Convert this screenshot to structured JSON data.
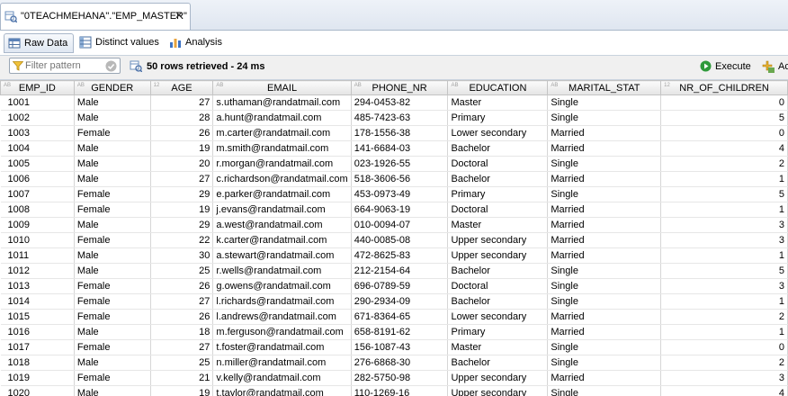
{
  "editor_tab": {
    "title": "\"0TEACHMEHANA\".\"EMP_MASTER\"",
    "close": "✕"
  },
  "subtabs": [
    {
      "label": "Raw Data",
      "active": true
    },
    {
      "label": "Distinct values",
      "active": false
    },
    {
      "label": "Analysis",
      "active": false
    }
  ],
  "toolbar": {
    "filter_placeholder": "Filter pattern",
    "status": "50 rows retrieved - 24 ms",
    "execute_label": "Execute",
    "add_label": "Ac"
  },
  "columns": [
    {
      "name": "EMP_ID",
      "type": "AB",
      "align": "left"
    },
    {
      "name": "GENDER",
      "type": "AB",
      "align": "left"
    },
    {
      "name": "AGE",
      "type": "12",
      "align": "right"
    },
    {
      "name": "EMAIL",
      "type": "AB",
      "align": "left"
    },
    {
      "name": "PHONE_NR",
      "type": "AB",
      "align": "left"
    },
    {
      "name": "EDUCATION",
      "type": "AB",
      "align": "left"
    },
    {
      "name": "MARITAL_STAT",
      "type": "AB",
      "align": "left"
    },
    {
      "name": "NR_OF_CHILDREN",
      "type": "12",
      "align": "right"
    }
  ],
  "rows": [
    [
      "1001",
      "Male",
      "27",
      "s.uthaman@randatmail.com",
      "294-0453-82",
      "Master",
      "Single",
      "0"
    ],
    [
      "1002",
      "Male",
      "28",
      "a.hunt@randatmail.com",
      "485-7423-63",
      "Primary",
      "Single",
      "5"
    ],
    [
      "1003",
      "Female",
      "26",
      "m.carter@randatmail.com",
      "178-1556-38",
      "Lower secondary",
      "Married",
      "0"
    ],
    [
      "1004",
      "Male",
      "19",
      "m.smith@randatmail.com",
      "141-6684-03",
      "Bachelor",
      "Married",
      "4"
    ],
    [
      "1005",
      "Male",
      "20",
      "r.morgan@randatmail.com",
      "023-1926-55",
      "Doctoral",
      "Single",
      "2"
    ],
    [
      "1006",
      "Male",
      "27",
      "c.richardson@randatmail.com",
      "518-3606-56",
      "Bachelor",
      "Married",
      "1"
    ],
    [
      "1007",
      "Female",
      "29",
      "e.parker@randatmail.com",
      "453-0973-49",
      "Primary",
      "Single",
      "5"
    ],
    [
      "1008",
      "Female",
      "19",
      "j.evans@randatmail.com",
      "664-9063-19",
      "Doctoral",
      "Married",
      "1"
    ],
    [
      "1009",
      "Male",
      "29",
      "a.west@randatmail.com",
      "010-0094-07",
      "Master",
      "Married",
      "3"
    ],
    [
      "1010",
      "Female",
      "22",
      "k.carter@randatmail.com",
      "440-0085-08",
      "Upper secondary",
      "Married",
      "3"
    ],
    [
      "1011",
      "Male",
      "30",
      "a.stewart@randatmail.com",
      "472-8625-83",
      "Upper secondary",
      "Married",
      "1"
    ],
    [
      "1012",
      "Male",
      "25",
      "r.wells@randatmail.com",
      "212-2154-64",
      "Bachelor",
      "Single",
      "5"
    ],
    [
      "1013",
      "Female",
      "26",
      "g.owens@randatmail.com",
      "696-0789-59",
      "Doctoral",
      "Single",
      "3"
    ],
    [
      "1014",
      "Female",
      "27",
      "l.richards@randatmail.com",
      "290-2934-09",
      "Bachelor",
      "Single",
      "1"
    ],
    [
      "1015",
      "Female",
      "26",
      "l.andrews@randatmail.com",
      "671-8364-65",
      "Lower secondary",
      "Married",
      "2"
    ],
    [
      "1016",
      "Male",
      "18",
      "m.ferguson@randatmail.com",
      "658-8191-62",
      "Primary",
      "Married",
      "1"
    ],
    [
      "1017",
      "Female",
      "27",
      "t.foster@randatmail.com",
      "156-1087-43",
      "Master",
      "Single",
      "0"
    ],
    [
      "1018",
      "Male",
      "25",
      "n.miller@randatmail.com",
      "276-6868-30",
      "Bachelor",
      "Single",
      "2"
    ],
    [
      "1019",
      "Female",
      "21",
      "v.kelly@randatmail.com",
      "282-5750-98",
      "Upper secondary",
      "Married",
      "3"
    ],
    [
      "1020",
      "Male",
      "19",
      "t.taylor@randatmail.com",
      "110-1269-16",
      "Upper secondary",
      "Single",
      "4"
    ]
  ]
}
